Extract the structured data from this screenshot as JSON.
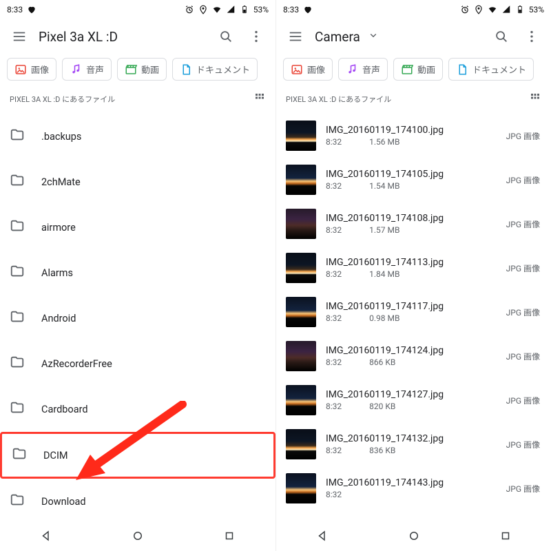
{
  "status": {
    "time": "8:33",
    "battery_text": "53%"
  },
  "left": {
    "title": "Pixel 3a XL :D",
    "chips": {
      "image": "画像",
      "audio": "音声",
      "video": "動画",
      "doc": "ドキュメント"
    },
    "path_text": "PIXEL 3A XL :D にあるファイル",
    "folders": [
      ".backups",
      "2chMate",
      "airmore",
      "Alarms",
      "Android",
      "AzRecorderFree",
      "Cardboard",
      "DCIM",
      "Download"
    ],
    "highlight_index": 7
  },
  "right": {
    "title": "Camera",
    "chips": {
      "image": "画像",
      "audio": "音声",
      "video": "動画",
      "doc": "ドキュメント"
    },
    "path_text": "PIXEL 3A XL :D にあるファイル",
    "type_label": "JPG 画像",
    "files": [
      {
        "name": "IMG_20160119_174100.jpg",
        "time": "8:32",
        "size": "1.56 MB",
        "t": "v1"
      },
      {
        "name": "IMG_20160119_174105.jpg",
        "time": "8:32",
        "size": "1.54 MB",
        "t": "v2"
      },
      {
        "name": "IMG_20160119_174108.jpg",
        "time": "8:32",
        "size": "1.57 MB",
        "t": "v3"
      },
      {
        "name": "IMG_20160119_174113.jpg",
        "time": "8:32",
        "size": "1.84 MB",
        "t": "v1"
      },
      {
        "name": "IMG_20160119_174117.jpg",
        "time": "8:32",
        "size": "0.98 MB",
        "t": "v2"
      },
      {
        "name": "IMG_20160119_174124.jpg",
        "time": "8:32",
        "size": "866 KB",
        "t": "v3"
      },
      {
        "name": "IMG_20160119_174127.jpg",
        "time": "8:32",
        "size": "820 KB",
        "t": "v2"
      },
      {
        "name": "IMG_20160119_174132.jpg",
        "time": "8:32",
        "size": "836 KB",
        "t": "v1"
      },
      {
        "name": "IMG_20160119_174143.jpg",
        "time": "8:32",
        "size": "",
        "t": "v2"
      }
    ]
  }
}
